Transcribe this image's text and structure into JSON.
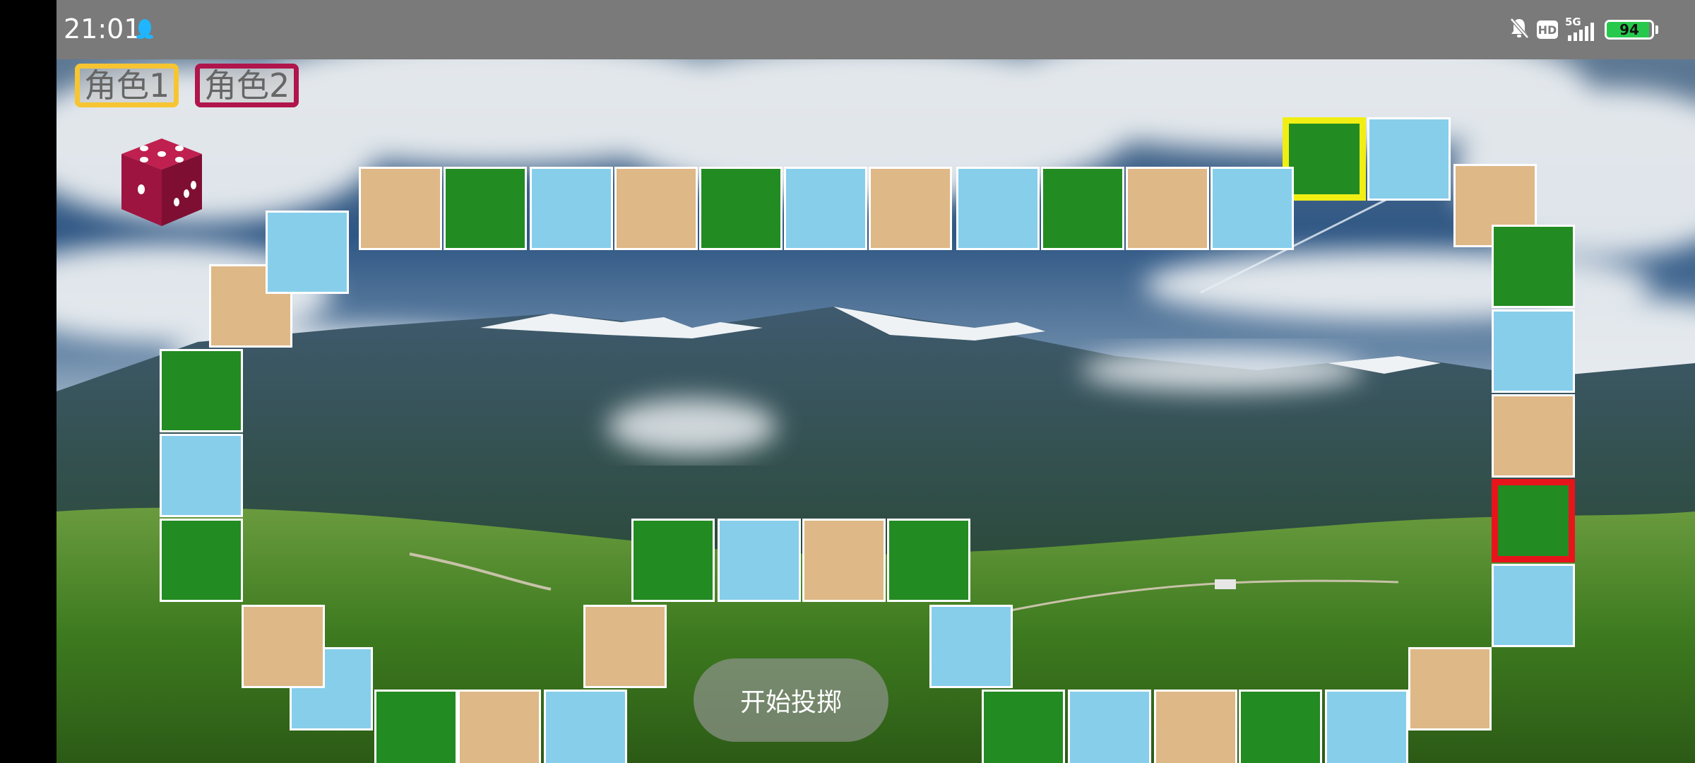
{
  "status_bar": {
    "time": "21:01",
    "network": "5G",
    "hd": "HD",
    "battery_level": 94,
    "battery_text": "94"
  },
  "players": [
    {
      "label": "角色1",
      "color": "#f6c531"
    },
    {
      "label": "角色2",
      "color": "#b0154c"
    }
  ],
  "dice": {
    "icon": "dice-icon",
    "color": "#b0154c"
  },
  "actions": {
    "start_label": "开始投掷"
  },
  "tile_colors": {
    "blue": "#87ceeb",
    "tan": "#deb887",
    "green": "#228b22"
  },
  "board": {
    "path": [
      "green",
      "blue",
      "tan",
      "green",
      "blue",
      "tan",
      "green",
      "blue",
      "tan",
      "blue",
      "green",
      "tan",
      "blue",
      "green",
      "blue",
      "green",
      "tan",
      "blue",
      "green",
      "tan",
      "blue",
      "tan",
      "green",
      "blue",
      "tan",
      "green",
      "blue",
      "green",
      "tan",
      "blue",
      "tan",
      "green",
      "blue",
      "tan",
      "green",
      "blue",
      "tan",
      "blue",
      "green",
      "tan",
      "blue",
      "green"
    ],
    "player1_tile_index": 0,
    "player2_tile_index": 6
  }
}
